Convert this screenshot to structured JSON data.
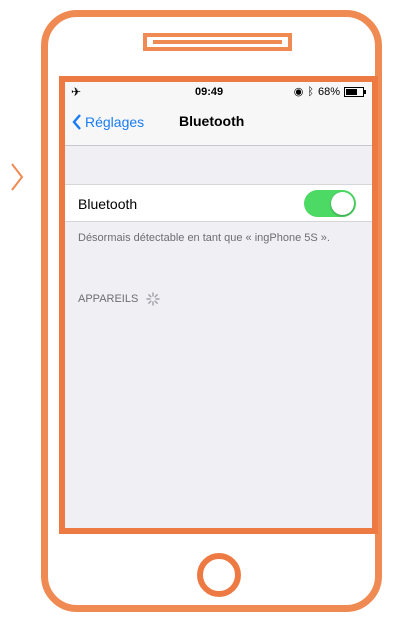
{
  "colors": {
    "frame_orange": "#f08a53",
    "frame_orange_dark": "#ee7a43",
    "ios_blue": "#1a7cf5",
    "toggle_green": "#4cd964",
    "grouped_background": "#efeff4"
  },
  "status_bar": {
    "left_icon": "airplane-icon",
    "time": "09:49",
    "location_icon": "location-icon",
    "bluetooth_icon": "bluetooth-icon",
    "battery_percent": "68%",
    "battery_icon": "battery-icon"
  },
  "nav": {
    "back_label": "Réglages",
    "title": "Bluetooth"
  },
  "bluetooth_row": {
    "label": "Bluetooth",
    "toggle_on": true
  },
  "discoverable_text": "Désormais détectable en tant que « ingPhone 5S ».",
  "devices_header": "APPAREILS",
  "decor": {
    "pointer_icon": "chevron-right-icon",
    "home_button_icon": "home-button-icon"
  }
}
